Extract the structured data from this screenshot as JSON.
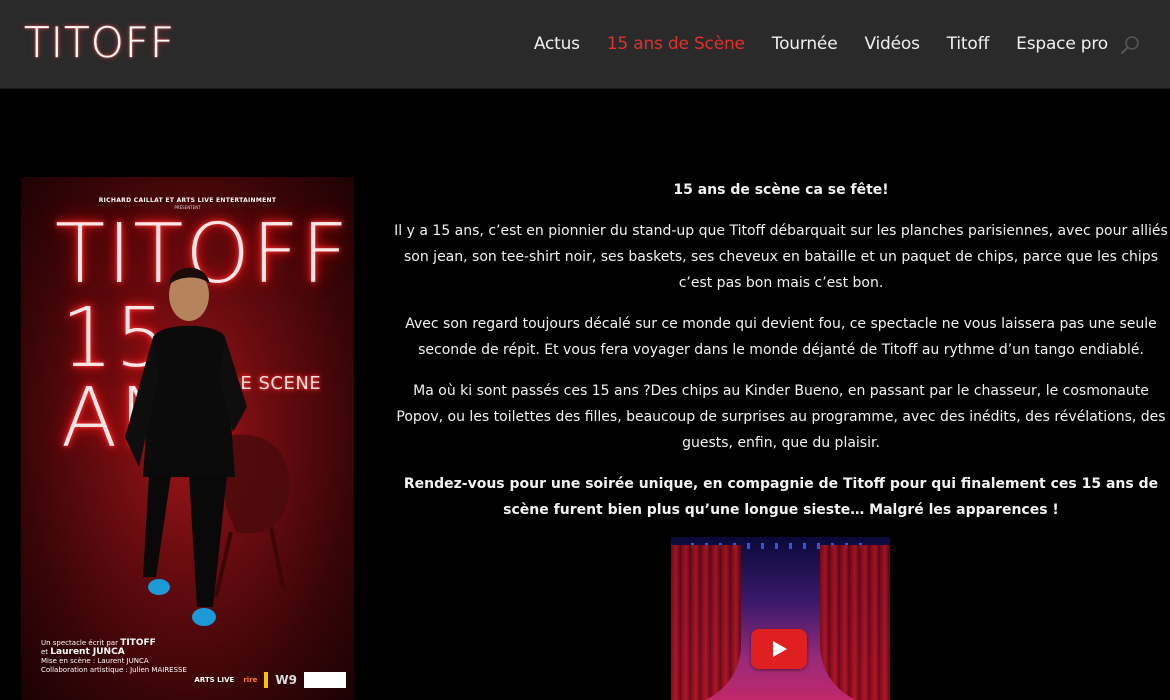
{
  "header": {
    "logo": "TITOFF",
    "nav": [
      {
        "label": "Actus",
        "active": false
      },
      {
        "label": "15 ans de Scène",
        "active": true
      },
      {
        "label": "Tournée",
        "active": false
      },
      {
        "label": "Vidéos",
        "active": false
      },
      {
        "label": "Titoff",
        "active": false
      },
      {
        "label": "Espace pro",
        "active": false
      }
    ],
    "search_icon": "search-icon",
    "accent_color": "#e0312b"
  },
  "poster": {
    "producer": "RICHARD CAILLAT ET ARTS LIVE ENTERTAINMENT",
    "producer_sub": "PRÉSENTENT",
    "title": "TITOFF",
    "subtitle": "15 ANS",
    "tagline": "DE SCENE",
    "credits_line1": "Un spectacle écrit par",
    "credits_name1": "TITOFF",
    "credits_line2": "et",
    "credits_name2": "Laurent JUNCA",
    "credits_line3": "Mise en scène : Laurent JUNCA",
    "credits_line4": "Collaboration artistique : Julien MAIRESSE",
    "logos": [
      "ARTS LIVE",
      "rire",
      "W9"
    ]
  },
  "content": {
    "heading": "15 ans de scène ca se fête!",
    "para1": "Il y a 15 ans, c’est en pionnier du stand-up que Titoff débarquait sur les planches parisiennes, avec pour alliés son jean, son tee-shirt noir, ses baskets, ses cheveux en bataille et un paquet de chips, parce que les chips c’est pas bon mais c’est bon.",
    "para2": "Avec son regard toujours décalé sur ce monde qui devient fou, ce spectacle ne vous laissera pas une seule seconde de répit. Et vous fera voyager dans le monde déjanté de Titoff au rythme d’un tango endiablé.",
    "para3": "Ma où ki sont passés ces 15 ans ?Des chips au Kinder Bueno, en passant par le chasseur, le cosmonaute Popov, ou les toilettes des filles, beaucoup de surprises au programme, avec des inédits, des révélations, des guests, enfin, que du plaisir.",
    "para4": "Rendez-vous pour une soirée unique, en compagnie de Titoff pour qui finalement ces 15 ans de scène furent bien plus qu’une longue sieste… Malgré les apparences !"
  },
  "video": {
    "play_icon": "play-icon"
  }
}
